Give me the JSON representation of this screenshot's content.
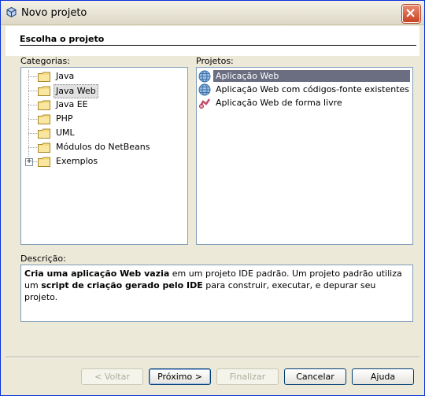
{
  "window": {
    "title": "Novo projeto",
    "icon": "netbeans-cube-icon",
    "close_icon": "close-icon"
  },
  "header": {
    "title": "Escolha o projeto"
  },
  "categories": {
    "label": "Categorias:",
    "items": [
      {
        "label": "Java",
        "icon": "folder-icon",
        "expandable": false,
        "selected": false
      },
      {
        "label": "Java Web",
        "icon": "folder-icon",
        "expandable": false,
        "selected": true
      },
      {
        "label": "Java EE",
        "icon": "folder-icon",
        "expandable": false,
        "selected": false
      },
      {
        "label": "PHP",
        "icon": "folder-icon",
        "expandable": false,
        "selected": false
      },
      {
        "label": "UML",
        "icon": "folder-icon",
        "expandable": false,
        "selected": false
      },
      {
        "label": "Módulos do NetBeans",
        "icon": "folder-icon",
        "expandable": false,
        "selected": false
      },
      {
        "label": "Exemplos",
        "icon": "folder-icon",
        "expandable": true,
        "selected": false
      }
    ]
  },
  "projects": {
    "label": "Projetos:",
    "items": [
      {
        "label": "Aplicação Web",
        "icon": "globe-icon",
        "selected": true
      },
      {
        "label": "Aplicação Web com códigos-fonte existentes",
        "icon": "globe-icon",
        "selected": false
      },
      {
        "label": "Aplicação Web de forma livre",
        "icon": "free-form-web-icon",
        "selected": false
      }
    ]
  },
  "description": {
    "label": "Descrição:",
    "parts": [
      {
        "text": "Cria uma aplicação Web vazia",
        "bold": true
      },
      {
        "text": " em um projeto IDE padrão. Um projeto padrão utiliza um ",
        "bold": false
      },
      {
        "text": "script de criação gerado pelo IDE",
        "bold": true
      },
      {
        "text": " para construir, executar, e depurar seu projeto.",
        "bold": false
      }
    ]
  },
  "buttons": {
    "back": "< Voltar",
    "next": "Próximo >",
    "finish": "Finalizar",
    "cancel": "Cancelar",
    "help": "Ajuda"
  },
  "colors": {
    "selection": "#6b6e81",
    "panel_border": "#7f9db9",
    "dialog_bg": "#ece9d8"
  }
}
